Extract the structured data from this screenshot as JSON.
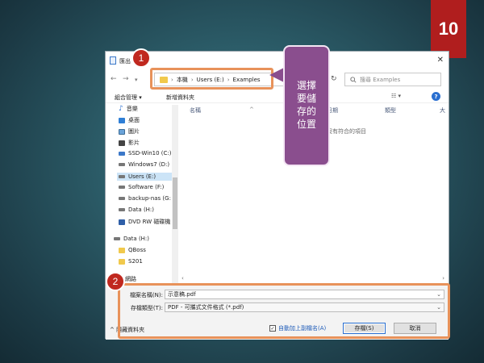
{
  "slide_number": "10",
  "dialog": {
    "title": "匯出",
    "close": "✕"
  },
  "address": {
    "crumbs": [
      "本機",
      "Users (E:)",
      "Examples"
    ],
    "separator": "›",
    "search_placeholder": "搜尋 Examples"
  },
  "toolbar": {
    "organize": "組合管理 ▾",
    "new_folder": "新增資料夾"
  },
  "nav_items": [
    {
      "label": "音樂",
      "icon": "music-icon"
    },
    {
      "label": "桌面",
      "icon": "desktop-icon"
    },
    {
      "label": "圖片",
      "icon": "pictures-icon"
    },
    {
      "label": "影片",
      "icon": "video-icon"
    },
    {
      "label": "SSD-Win10 (C:)",
      "icon": "drive-icon"
    },
    {
      "label": "Windows7 (D:)",
      "icon": "drive-icon"
    },
    {
      "label": "Users (E:)",
      "icon": "drive-icon"
    },
    {
      "label": "Software (F:)",
      "icon": "drive-icon"
    },
    {
      "label": "backup-nas (G:",
      "icon": "network-drive-icon"
    },
    {
      "label": "Data (H:)",
      "icon": "drive-icon"
    },
    {
      "label": "DVD RW 磁碟機",
      "icon": "dvd-icon"
    },
    {
      "label": "Data (H:)",
      "icon": "drive-icon"
    },
    {
      "label": "QBoss",
      "icon": "folder-icon"
    },
    {
      "label": "S201",
      "icon": "folder-icon"
    },
    {
      "label": "網路",
      "icon": "network-icon"
    }
  ],
  "columns": {
    "name": "名稱",
    "date": "日期",
    "type": "類型",
    "size": "大"
  },
  "empty_message": "沒有符合的項目",
  "file_name": {
    "label": "檔案名稱(N):",
    "value": "示意稿.pdf"
  },
  "file_type": {
    "label": "存檔類型(T):",
    "value": "PDF - 可攜式文件格式 (*.pdf)"
  },
  "hide_folders": "隱藏資料夾",
  "auto_ext": "自動加上副檔名(A)",
  "save_button": "存檔(S)",
  "cancel_button": "取消",
  "callouts": {
    "one": "1",
    "two": "2",
    "bubble_text": "選擇要儲存的位置"
  },
  "colors": {
    "callout_border": "#e8925a",
    "badge": "#c0281f",
    "bubble": "#8a4e8e",
    "slide_number_bg": "#b01e1e"
  }
}
